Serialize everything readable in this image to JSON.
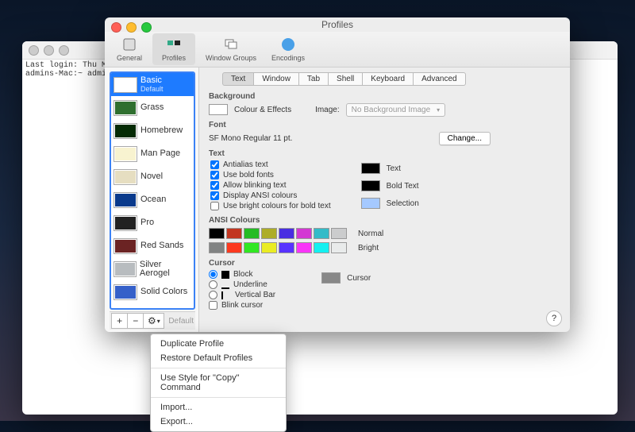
{
  "terminal": {
    "line1": "Last login: Thu May",
    "line2": "admins-Mac:~ admin$"
  },
  "prefs": {
    "title": "Profiles",
    "toolbar": {
      "general": "General",
      "profiles": "Profiles",
      "windowgroups": "Window Groups",
      "encodings": "Encodings"
    },
    "profiles": [
      {
        "name": "Basic",
        "sub": "Default",
        "thumb": "#fff"
      },
      {
        "name": "Grass",
        "thumb": "#2f6f2f"
      },
      {
        "name": "Homebrew",
        "thumb": "#052b05"
      },
      {
        "name": "Man Page",
        "thumb": "#f8f3d0"
      },
      {
        "name": "Novel",
        "thumb": "#e6dec1"
      },
      {
        "name": "Ocean",
        "thumb": "#0a3a8c"
      },
      {
        "name": "Pro",
        "thumb": "#222"
      },
      {
        "name": "Red Sands",
        "thumb": "#6b2323"
      },
      {
        "name": "Silver Aerogel",
        "thumb": "#b8bcbf"
      },
      {
        "name": "Solid Colors",
        "thumb": "#3560c9"
      }
    ],
    "footer": {
      "add": "+",
      "remove": "−",
      "default": "Default"
    },
    "tabs": {
      "text": "Text",
      "window": "Window",
      "tab": "Tab",
      "shell": "Shell",
      "keyboard": "Keyboard",
      "advanced": "Advanced"
    },
    "background": {
      "h": "Background",
      "col": "Colour & Effects",
      "imgl": "Image:",
      "img": "No Background Image"
    },
    "font": {
      "h": "Font",
      "desc": "SF Mono Regular 11 pt.",
      "change": "Change..."
    },
    "text": {
      "h": "Text",
      "antialias": "Antialias text",
      "bold": "Use bold fonts",
      "blink": "Allow blinking text",
      "ansi": "Display ANSI colours",
      "bright": "Use bright colours for bold text",
      "lab_text": "Text",
      "lab_bold": "Bold Text",
      "lab_sel": "Selection"
    },
    "ansi": {
      "h": "ANSI Colours",
      "normal": "Normal",
      "bright": "Bright",
      "row1": [
        "#000",
        "#c23621",
        "#25bc24",
        "#adad27",
        "#492ee1",
        "#d338d3",
        "#33bbc8",
        "#cbcccd"
      ],
      "row2": [
        "#818383",
        "#fc391f",
        "#31e722",
        "#eaec23",
        "#5833ff",
        "#f935f8",
        "#14f0f0",
        "#e9ebeb"
      ]
    },
    "cursor": {
      "h": "Cursor",
      "block": "Block",
      "underline": "Underline",
      "vbar": "Vertical Bar",
      "blink": "Blink cursor",
      "lab": "Cursor"
    }
  },
  "menu": {
    "dup": "Duplicate Profile",
    "restore": "Restore Default Profiles",
    "usestyle": "Use Style for \"Copy\" Command",
    "import": "Import...",
    "export": "Export..."
  }
}
